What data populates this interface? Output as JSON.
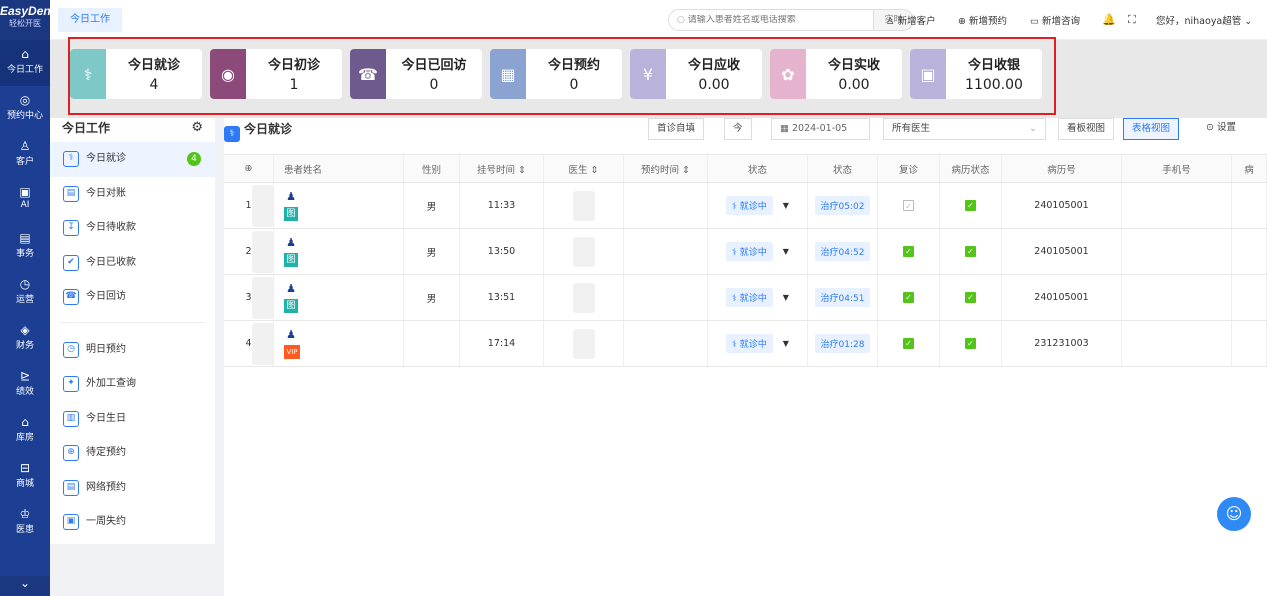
{
  "app": {
    "logo": "EasyDent",
    "logo_sub": "轻松开医"
  },
  "nav": [
    {
      "icon": "⌂",
      "label": "今日工作"
    },
    {
      "icon": "◎",
      "label": "预约中心"
    },
    {
      "icon": "♙",
      "label": "客户"
    },
    {
      "icon": "▣",
      "label": "AI"
    },
    {
      "icon": "▤",
      "label": "事务"
    },
    {
      "icon": "◷",
      "label": "运营"
    },
    {
      "icon": "◈",
      "label": "财务"
    },
    {
      "icon": "⊵",
      "label": "绩效"
    },
    {
      "icon": "⌂",
      "label": "库房"
    },
    {
      "icon": "⊟",
      "label": "商城"
    },
    {
      "icon": "♔",
      "label": "医患"
    }
  ],
  "nav_more": "⌄",
  "topbar": {
    "tab": "今日工作",
    "search_placeholder": "请输入患者姓名或电话搜索",
    "search_btn": "实时",
    "actions": [
      {
        "icon": "♙",
        "label": "新增客户"
      },
      {
        "icon": "⊕",
        "label": "新增预约"
      },
      {
        "icon": "▭",
        "label": "新增咨询"
      }
    ],
    "bell": "🔔",
    "fullscreen": "⛶",
    "greeting": "您好，nihaoya超管"
  },
  "cards": [
    {
      "title": "今日就诊",
      "value": "4",
      "color": "#7ec8c8",
      "icon": "⚕"
    },
    {
      "title": "今日初诊",
      "value": "1",
      "color": "#8c4a7a",
      "icon": "◉"
    },
    {
      "title": "今日已回访",
      "value": "0",
      "color": "#6e5a8c",
      "icon": "☎"
    },
    {
      "title": "今日预约",
      "value": "0",
      "color": "#8aa3d0",
      "icon": "▦"
    },
    {
      "title": "今日应收",
      "value": "0.00",
      "color": "#b9b3dc",
      "icon": "¥"
    },
    {
      "title": "今日实收",
      "value": "0.00",
      "color": "#e6b3cf",
      "icon": "✿"
    },
    {
      "title": "今日收银",
      "value": "1100.00",
      "color": "#b9b3dc",
      "icon": "▣"
    }
  ],
  "sidebar": {
    "title": "今日工作",
    "items": [
      {
        "label": "今日就诊",
        "icon": "⚕",
        "badge": "4",
        "active": true
      },
      {
        "label": "今日对账",
        "icon": "▤"
      },
      {
        "label": "今日待收款",
        "icon": "↧"
      },
      {
        "label": "今日已收款",
        "icon": "✔"
      },
      {
        "label": "今日回访",
        "icon": "☎"
      }
    ],
    "items2": [
      {
        "label": "明日预约",
        "icon": "◷"
      },
      {
        "label": "外加工查询",
        "icon": "✦"
      },
      {
        "label": "今日生日",
        "icon": "▥"
      },
      {
        "label": "待定预约",
        "icon": "⊕"
      },
      {
        "label": "网络预约",
        "icon": "▤"
      },
      {
        "label": "一周失约",
        "icon": "▣"
      }
    ]
  },
  "main": {
    "title": "今日就诊",
    "filters": {
      "self": "首诊自填",
      "today": "今",
      "date": "2024-01-05",
      "doctor": "所有医生",
      "board": "看板视图",
      "table": "表格视图",
      "settings": "设置"
    },
    "columns": [
      "",
      "患者姓名",
      "性别",
      "挂号时间 ⇕",
      "医生 ⇕",
      "预约时间 ⇕",
      "状态",
      "状态",
      "复诊",
      "病历状态",
      "病历号",
      "手机号",
      "病"
    ],
    "rows": [
      {
        "no": "1",
        "tag": "图",
        "sex": "男",
        "time": "11:33",
        "status": "就诊中",
        "treat": "治疗05:02",
        "revisit": false,
        "record": true,
        "mrn": "240105001"
      },
      {
        "no": "2",
        "tag": "图",
        "sex": "男",
        "time": "13:50",
        "status": "就诊中",
        "treat": "治疗04:52",
        "revisit": true,
        "record": true,
        "mrn": "240105001"
      },
      {
        "no": "3",
        "tag": "图",
        "sex": "男",
        "time": "13:51",
        "status": "就诊中",
        "treat": "治疗04:51",
        "revisit": true,
        "record": true,
        "mrn": "240105001"
      },
      {
        "no": "4",
        "tag": "VIP",
        "sex": "",
        "time": "17:14",
        "status": "就诊中",
        "treat": "治疗01:28",
        "revisit": true,
        "record": true,
        "mrn": "231231003"
      }
    ]
  }
}
